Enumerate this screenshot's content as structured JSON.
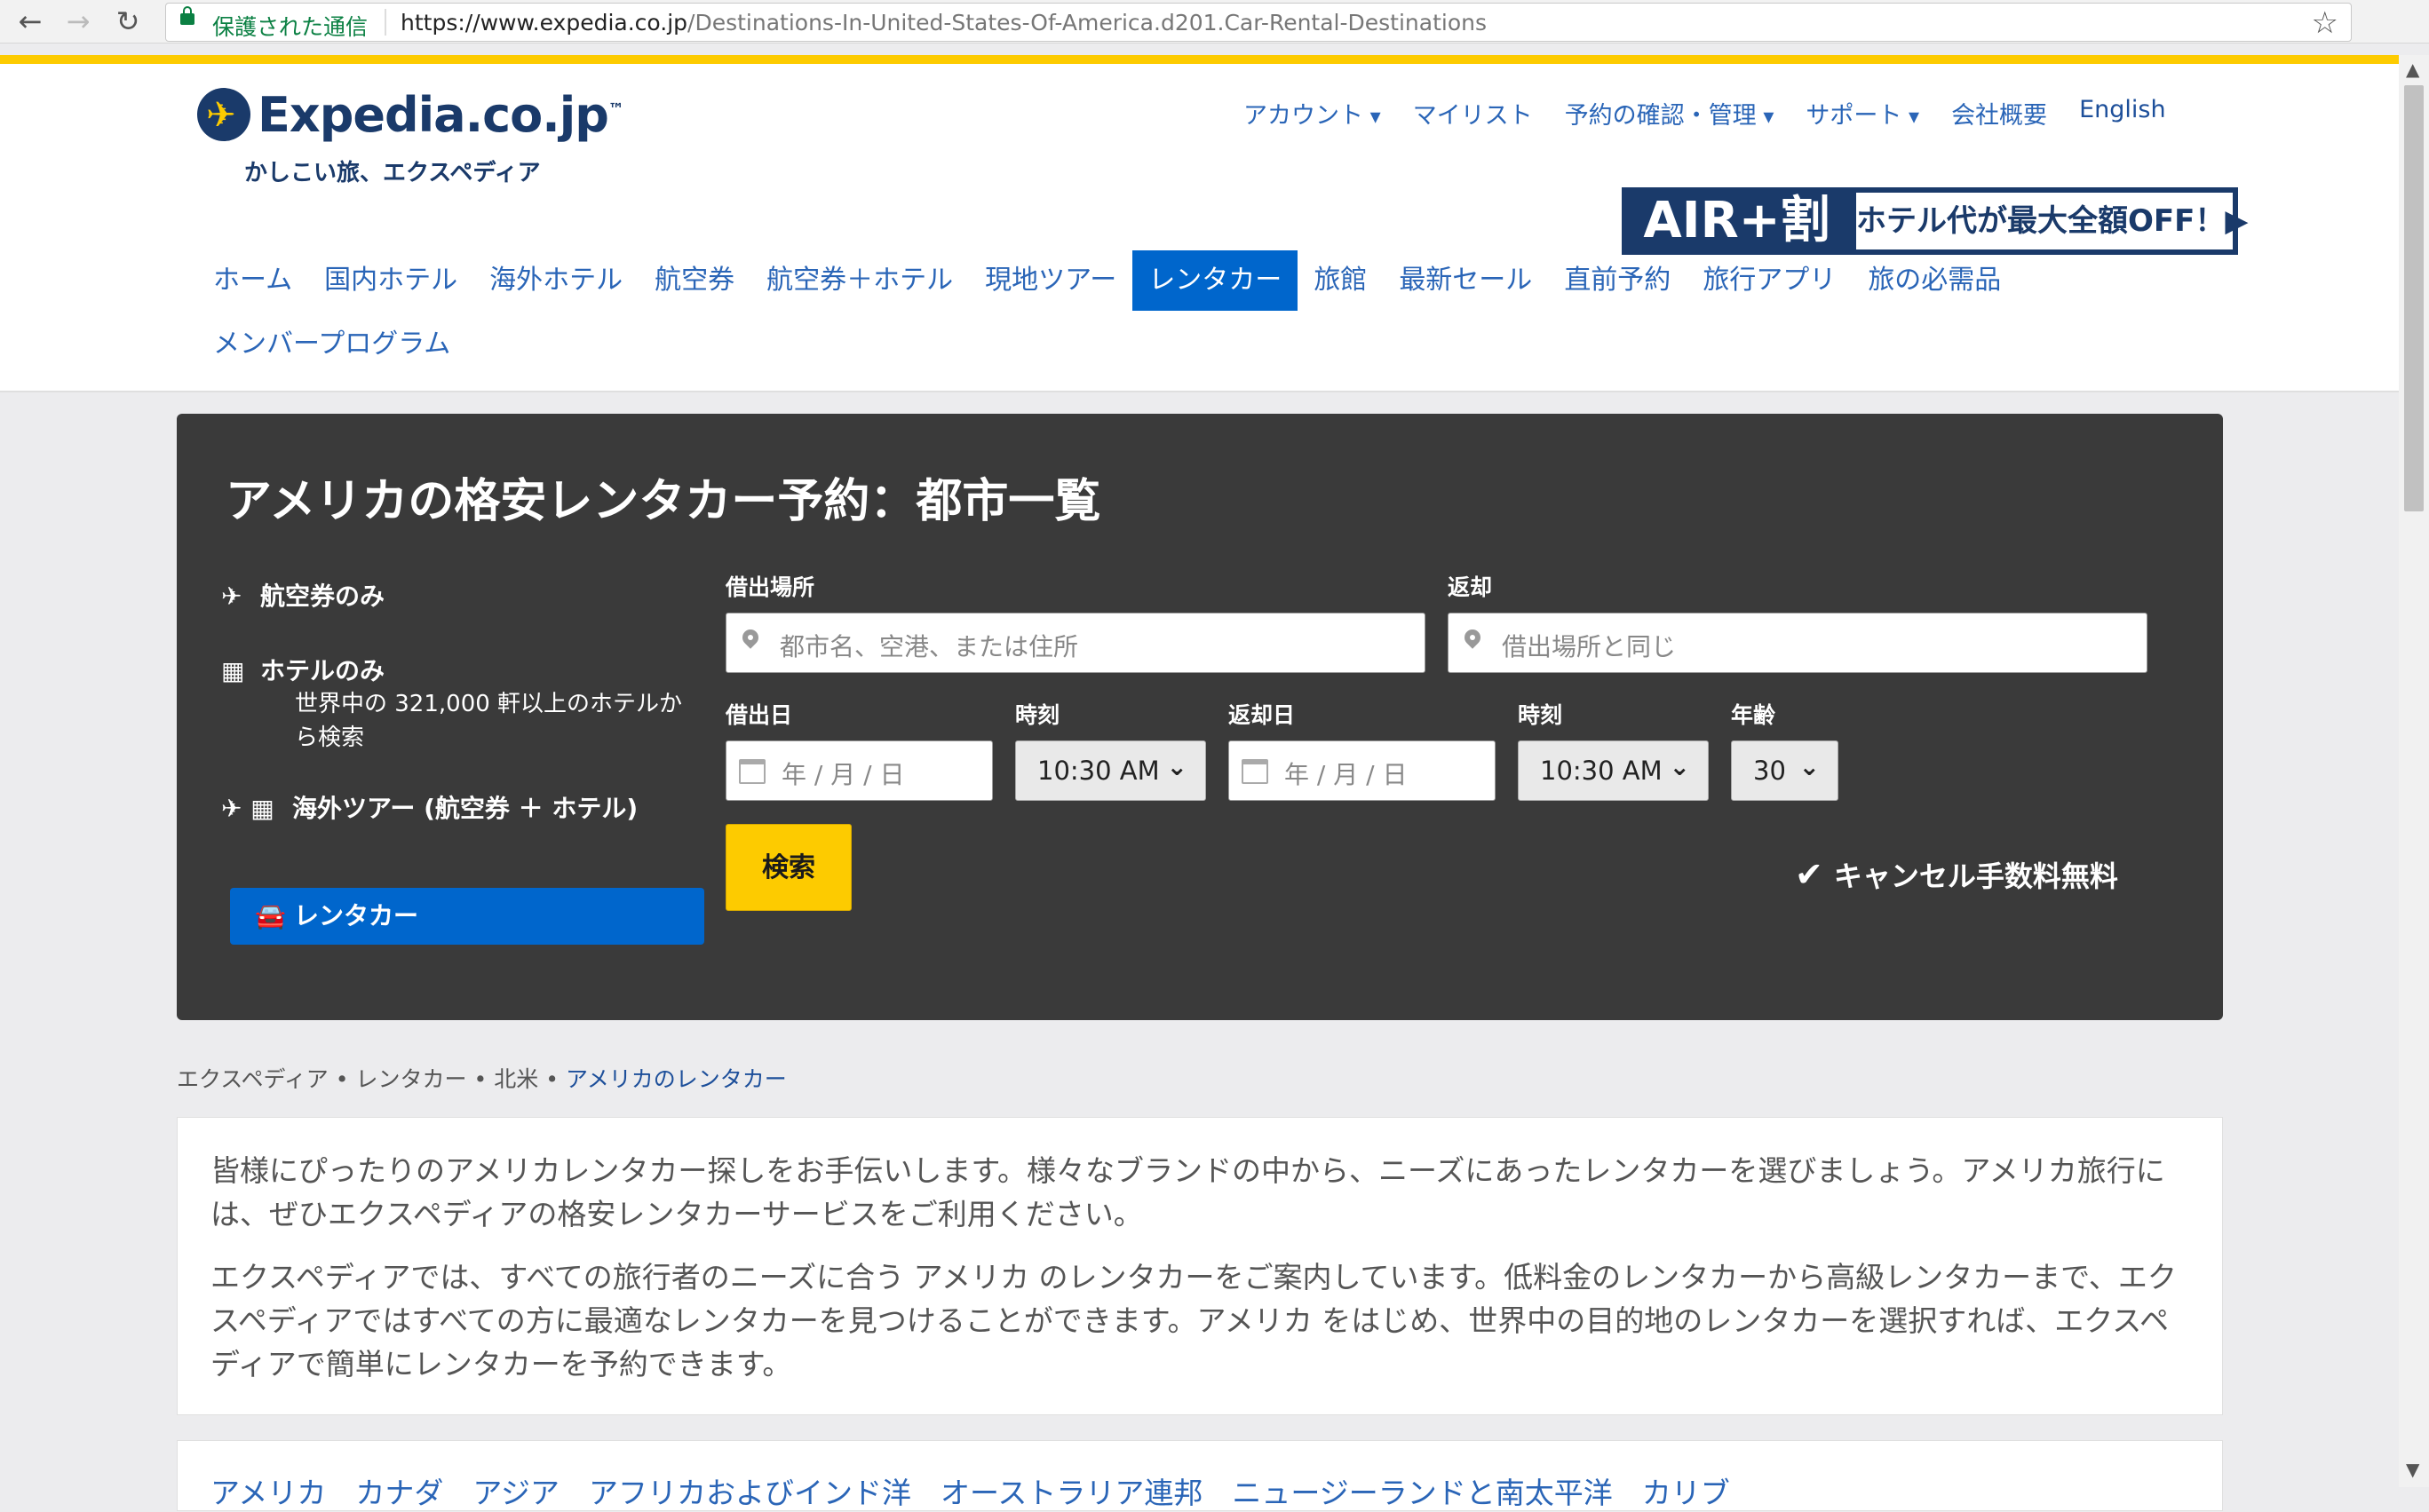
{
  "browser": {
    "secure_label": "保護された通信",
    "url_host": "https://www.expedia.co.jp",
    "url_path": "/Destinations-In-United-States-Of-America.d201.Car-Rental-Destinations",
    "back_icon": "←",
    "forward_icon": "→",
    "reload_icon": "↻",
    "star_icon": "☆"
  },
  "header": {
    "logo_text": "Expedia.co.jp",
    "logo_mark": "™",
    "tagline": "かしこい旅、エクスペディア",
    "util_nav": {
      "account": "アカウント",
      "mylist": "マイリスト",
      "booking": "予約の確認・管理",
      "support": "サポート",
      "company": "会社概要",
      "english": "English"
    },
    "promo": {
      "left": "AIR+割",
      "right": "ホテル代が最大全額OFF！▶"
    },
    "main_nav": [
      "ホーム",
      "国内ホテル",
      "海外ホテル",
      "航空券",
      "航空券＋ホテル",
      "現地ツアー",
      "レンタカー",
      "旅館",
      "最新セール",
      "直前予約",
      "旅行アプリ",
      "旅の必需品",
      "メンバープログラム"
    ],
    "active_index": 6
  },
  "search": {
    "title": "アメリカの格安レンタカー予約：都市一覧",
    "side": {
      "flight": "航空券のみ",
      "hotel": "ホテルのみ",
      "hotel_sub": "世界中の 321,000 軒以上のホテルから検索",
      "package": "海外ツアー (航空券 ＋ ホテル)",
      "car": "レンタカー"
    },
    "pickup_label": "借出場所",
    "pickup_placeholder": "都市名、空港、または住所",
    "dropoff_label": "返却",
    "dropoff_placeholder": "借出場所と同じ",
    "pickup_date_label": "借出日",
    "pickup_date_placeholder": "年 / 月 / 日",
    "pickup_time_label": "時刻",
    "pickup_time": "10:30 AM",
    "return_date_label": "返却日",
    "return_date_placeholder": "年 / 月 / 日",
    "return_time_label": "時刻",
    "return_time": "10:30 AM",
    "age_label": "年齢",
    "age": "30",
    "search_button": "検索",
    "free_cancel": "キャンセル手数料無料"
  },
  "breadcrumb": [
    "エクスペディア",
    "レンタカー",
    "北米",
    "アメリカのレンタカー"
  ],
  "content": {
    "para1": "皆様にぴったりのアメリカレンタカー探しをお手伝いします。様々なブランドの中から、ニーズにあったレンタカーを選びましょう。アメリカ旅行には、ぜひエクスペディアの格安レンタカーサービスをご利用ください。",
    "para2": "エクスペディアでは、すべての旅行者のニーズに合う アメリカ のレンタカーをご案内しています。低料金のレンタカーから高級レンタカーまで、エクスペディアではすべての方に最適なレンタカーを見つけることができます。アメリカ をはじめ、世界中の目的地のレンタカーを選択すれば、エクスペディアで簡単にレンタカーを予約できます。",
    "regions": "アメリカ　カナダ　アジア　アフリカおよびインド洋　オーストラリア連邦　ニュージーランドと南太平洋　カリブ"
  }
}
